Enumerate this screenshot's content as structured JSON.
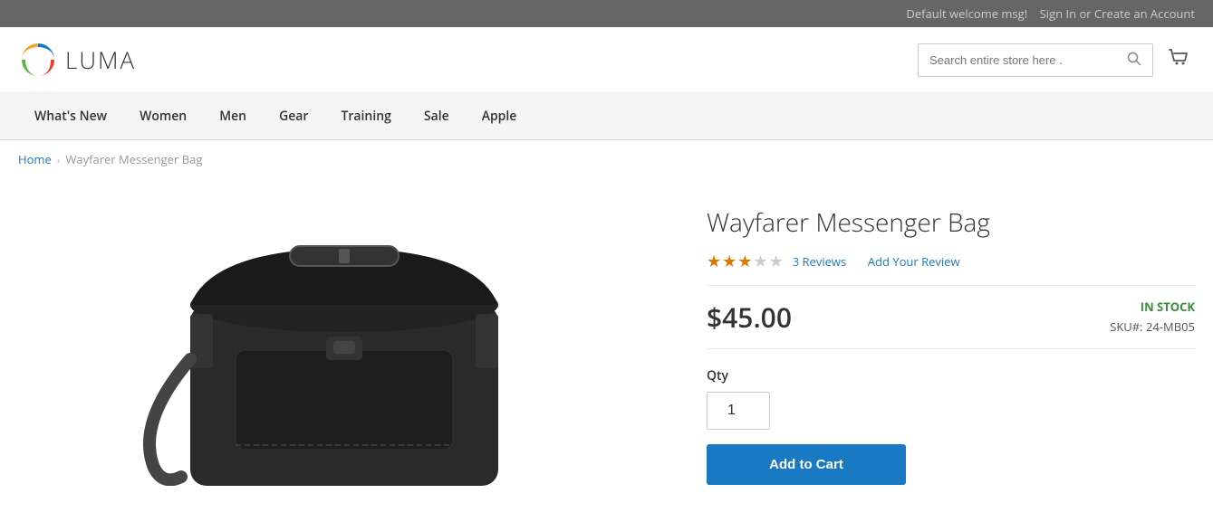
{
  "topbar": {
    "welcome": "Default welcome msg!",
    "signin": "Sign In",
    "or": "or",
    "create_account": "Create an Account"
  },
  "header": {
    "logo_text": "LUMA",
    "search_placeholder": "Search entire store here .",
    "cart_label": "Cart"
  },
  "nav": {
    "items": [
      {
        "label": "What's New",
        "href": "#"
      },
      {
        "label": "Women",
        "href": "#"
      },
      {
        "label": "Men",
        "href": "#"
      },
      {
        "label": "Gear",
        "href": "#"
      },
      {
        "label": "Training",
        "href": "#"
      },
      {
        "label": "Sale",
        "href": "#"
      },
      {
        "label": "Apple",
        "href": "#"
      }
    ]
  },
  "breadcrumb": {
    "home_label": "Home",
    "separator": "›",
    "current": "Wayfarer Messenger Bag"
  },
  "product": {
    "title": "Wayfarer Messenger Bag",
    "rating_filled": 3,
    "rating_empty": 2,
    "reviews_count": "3 Reviews",
    "add_review_label": "Add Your Review",
    "price": "$45.00",
    "stock_status": "IN STOCK",
    "sku_label": "SKU#:",
    "sku_value": "24-MB05",
    "qty_label": "Qty",
    "qty_value": "1",
    "add_to_cart_label": "Add to Cart"
  },
  "colors": {
    "accent": "#1979c3",
    "star_filled": "#e07600",
    "star_empty": "#cccccc",
    "in_stock": "#388e3c"
  }
}
